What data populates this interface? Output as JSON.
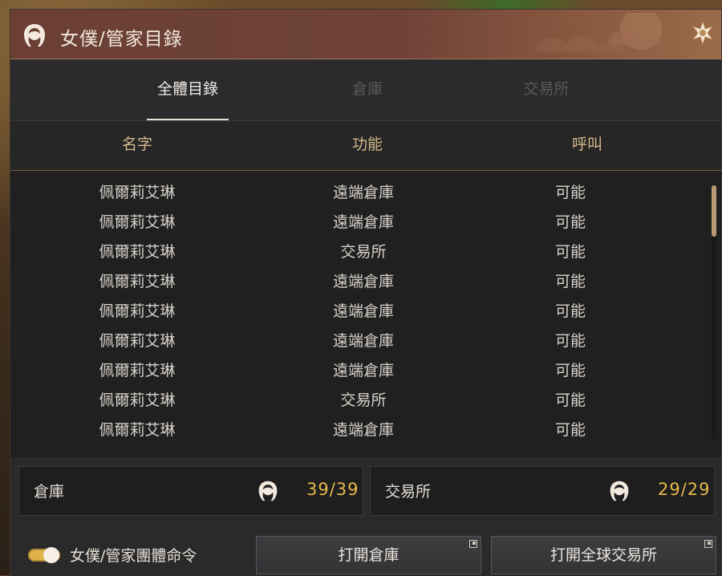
{
  "window": {
    "title": "女僕/管家目錄",
    "title_icon": "maid-icon",
    "settings_icon": "ornament-gear-icon"
  },
  "tabs": [
    {
      "label": "全體目錄",
      "active": true
    },
    {
      "label": "倉庫",
      "active": false
    },
    {
      "label": "交易所",
      "active": false
    }
  ],
  "columns": {
    "name": "名字",
    "function": "功能",
    "summon": "呼叫"
  },
  "rows": [
    {
      "name": "佩爾莉艾琳",
      "function": "遠端倉庫",
      "summon": "可能"
    },
    {
      "name": "佩爾莉艾琳",
      "function": "遠端倉庫",
      "summon": "可能"
    },
    {
      "name": "佩爾莉艾琳",
      "function": "交易所",
      "summon": "可能"
    },
    {
      "name": "佩爾莉艾琳",
      "function": "遠端倉庫",
      "summon": "可能"
    },
    {
      "name": "佩爾莉艾琳",
      "function": "遠端倉庫",
      "summon": "可能"
    },
    {
      "name": "佩爾莉艾琳",
      "function": "遠端倉庫",
      "summon": "可能"
    },
    {
      "name": "佩爾莉艾琳",
      "function": "遠端倉庫",
      "summon": "可能"
    },
    {
      "name": "佩爾莉艾琳",
      "function": "交易所",
      "summon": "可能"
    },
    {
      "name": "佩爾莉艾琳",
      "function": "遠端倉庫",
      "summon": "可能"
    }
  ],
  "scroll": {
    "position": 0.0,
    "visible_fraction": 0.2
  },
  "stats": {
    "warehouse": {
      "label": "倉庫",
      "value": "39/39"
    },
    "market": {
      "label": "交易所",
      "value": "29/29"
    }
  },
  "footer": {
    "group_command_label": "女僕/管家團體命令",
    "group_command_enabled": true,
    "open_warehouse_label": "打開倉庫",
    "open_market_label": "打開全球交易所"
  },
  "colors": {
    "accent_gold": "#e7b949",
    "column_header": "#d5b98a",
    "title_bar": "#6b3f34"
  }
}
